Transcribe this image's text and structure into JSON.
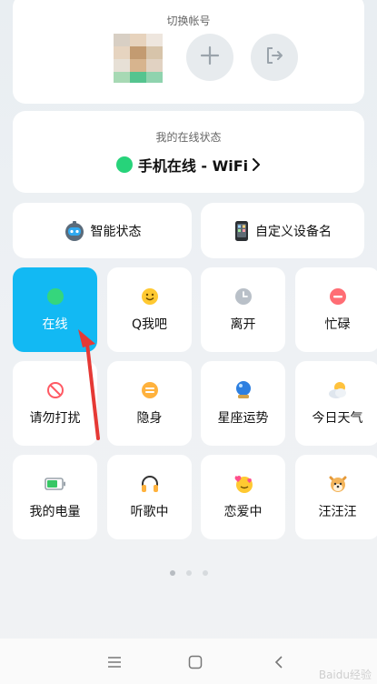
{
  "account": {
    "title": "切换帐号"
  },
  "status": {
    "title": "我的在线状态",
    "current": "手机在线 - WiFi",
    "dot_color": "#27d37a"
  },
  "features": [
    {
      "label": "智能状态",
      "icon": "robot-icon"
    },
    {
      "label": "自定义设备名",
      "icon": "phone-icon"
    }
  ],
  "grid": [
    {
      "label": "在线",
      "icon": "online-dot-icon",
      "active": true
    },
    {
      "label": "Q我吧",
      "icon": "smile-icon"
    },
    {
      "label": "离开",
      "icon": "clock-icon"
    },
    {
      "label": "忙碌",
      "icon": "busy-icon"
    },
    {
      "label": "请勿打扰",
      "icon": "no-disturb-icon"
    },
    {
      "label": "隐身",
      "icon": "invisible-icon"
    },
    {
      "label": "星座运势",
      "icon": "crystal-ball-icon"
    },
    {
      "label": "今日天气",
      "icon": "weather-icon"
    },
    {
      "label": "我的电量",
      "icon": "battery-icon"
    },
    {
      "label": "听歌中",
      "icon": "headphones-icon"
    },
    {
      "label": "恋爱中",
      "icon": "love-icon"
    },
    {
      "label": "汪汪汪",
      "icon": "dog-icon"
    }
  ],
  "pager": {
    "pages": 3,
    "current": 1
  },
  "nav": {
    "menu": "menu-icon",
    "home": "home-icon",
    "back": "back-icon"
  },
  "watermark": "Baidu经验",
  "colors": {
    "accent": "#12b9f3",
    "arrow": "#e53935"
  }
}
